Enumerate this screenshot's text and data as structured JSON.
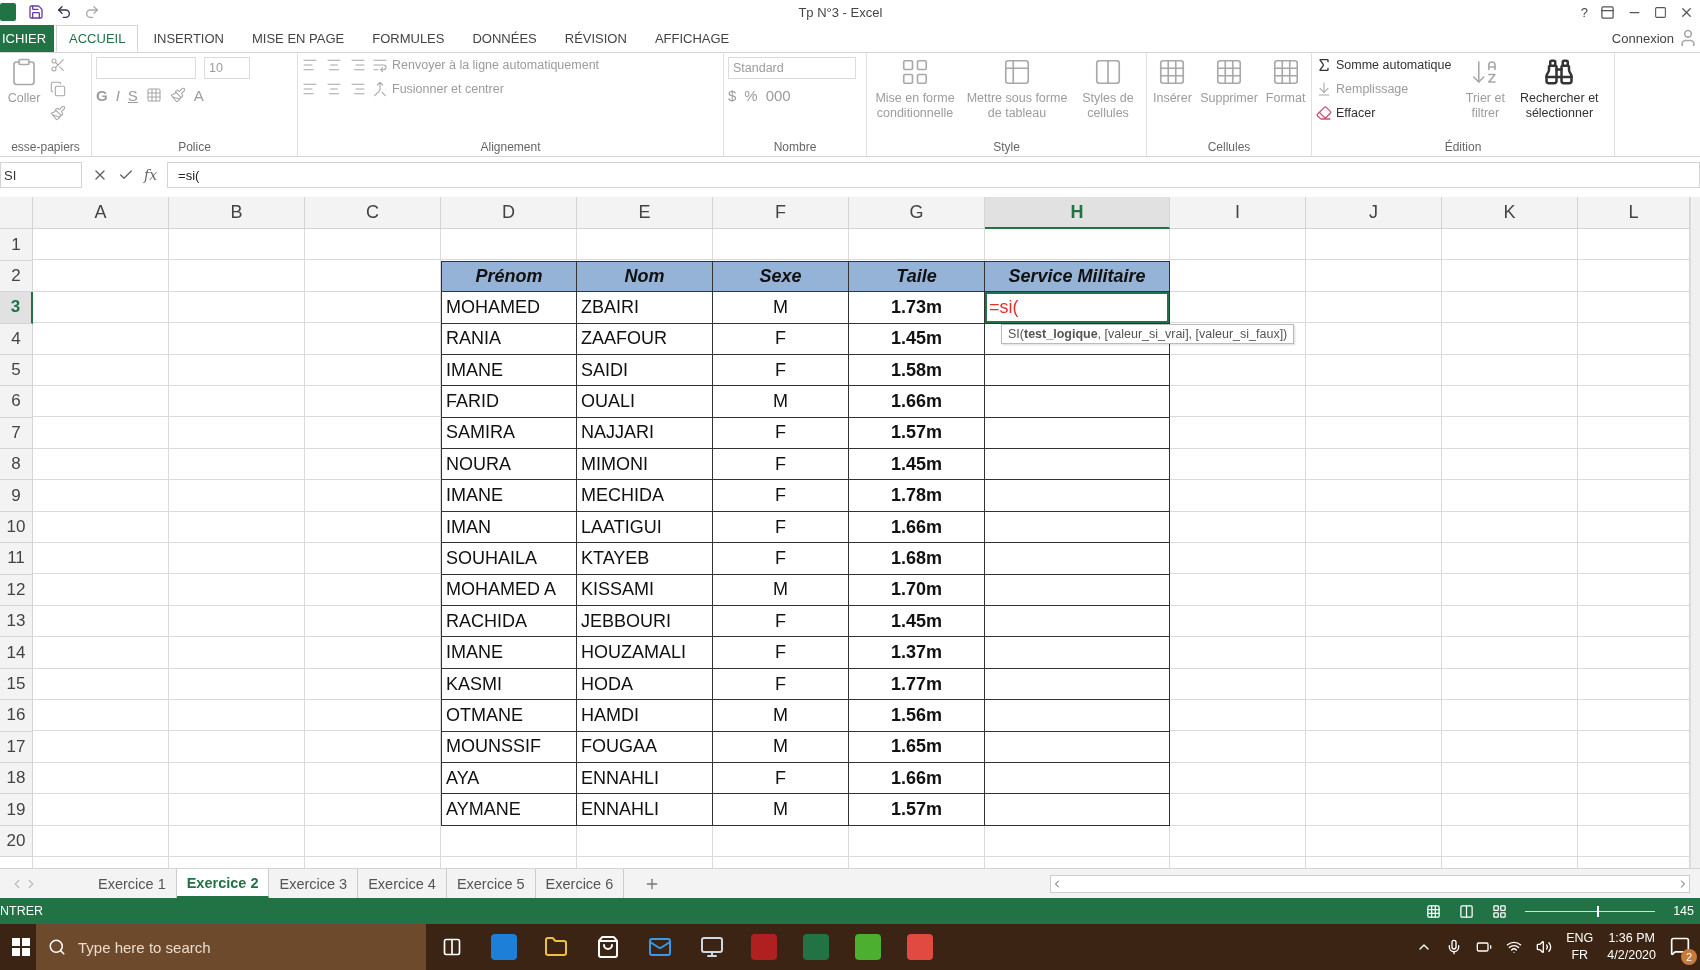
{
  "window": {
    "title": "Tp N°3 - Excel",
    "account": "Connexion",
    "help": "?"
  },
  "ribbon_tabs": [
    {
      "label": "ICHIER",
      "kind": "file",
      "selected": false
    },
    {
      "label": "ACCUEIL",
      "kind": "tab",
      "selected": true
    },
    {
      "label": "INSERTION",
      "kind": "tab",
      "selected": false
    },
    {
      "label": "MISE EN PAGE",
      "kind": "tab",
      "selected": false
    },
    {
      "label": "FORMULES",
      "kind": "tab",
      "selected": false
    },
    {
      "label": "DONNÉES",
      "kind": "tab",
      "selected": false
    },
    {
      "label": "RÉVISION",
      "kind": "tab",
      "selected": false
    },
    {
      "label": "AFFICHAGE",
      "kind": "tab",
      "selected": false
    }
  ],
  "ribbon": {
    "clipboard": {
      "label": "esse-papiers",
      "paste": "Coller"
    },
    "font": {
      "label": "Police",
      "size": "10",
      "bold": "G",
      "italic": "I",
      "underline": "S",
      "font_color": "A"
    },
    "alignment": {
      "label": "Alignement",
      "wrap": "Renvoyer à la ligne automatiquement",
      "merge": "Fusionner et centrer"
    },
    "number": {
      "label": "Nombre",
      "format": "Standard",
      "currency": "$",
      "percent": "%",
      "thousands": "000"
    },
    "style": {
      "label": "Style",
      "buttons": [
        "Mise en forme conditionnelle",
        "Mettre sous forme de tableau",
        "Styles de cellules"
      ]
    },
    "cells": {
      "label": "Cellules",
      "buttons": [
        "Insérer",
        "Supprimer",
        "Format"
      ]
    },
    "editing": {
      "label": "Édition",
      "autosum": "Somme automatique",
      "fill": "Remplissage",
      "clear": "Effacer",
      "sort": "Trier et filtrer",
      "find": "Rechercher et sélectionner"
    }
  },
  "formula_bar": {
    "name_box": "SI",
    "function_label": "fx",
    "formula": "=si("
  },
  "columns": [
    {
      "label": "A",
      "selected": false
    },
    {
      "label": "B",
      "selected": false
    },
    {
      "label": "C",
      "selected": false
    },
    {
      "label": "D",
      "selected": false
    },
    {
      "label": "E",
      "selected": false
    },
    {
      "label": "F",
      "selected": false
    },
    {
      "label": "G",
      "selected": false
    },
    {
      "label": "H",
      "selected": true
    },
    {
      "label": "I",
      "selected": false
    },
    {
      "label": "J",
      "selected": false
    },
    {
      "label": "K",
      "selected": false
    },
    {
      "label": "L",
      "selected": false
    }
  ],
  "row_headers": [
    {
      "label": "1",
      "selected": false
    },
    {
      "label": "2",
      "selected": false
    },
    {
      "label": "3",
      "selected": true
    },
    {
      "label": "4",
      "selected": false
    },
    {
      "label": "5",
      "selected": false
    },
    {
      "label": "6",
      "selected": false
    },
    {
      "label": "7",
      "selected": false
    },
    {
      "label": "8",
      "selected": false
    },
    {
      "label": "9",
      "selected": false
    },
    {
      "label": "10",
      "selected": false
    },
    {
      "label": "11",
      "selected": false
    },
    {
      "label": "12",
      "selected": false
    },
    {
      "label": "13",
      "selected": false
    },
    {
      "label": "14",
      "selected": false
    },
    {
      "label": "15",
      "selected": false
    },
    {
      "label": "16",
      "selected": false
    },
    {
      "label": "17",
      "selected": false
    },
    {
      "label": "18",
      "selected": false
    },
    {
      "label": "19",
      "selected": false
    },
    {
      "label": "20",
      "selected": false
    }
  ],
  "table": {
    "header": [
      "Prénom",
      "Nom",
      "Sexe",
      "Taile",
      "Service Militaire"
    ],
    "rows": [
      [
        "MOHAMED",
        "ZBAIRI",
        "M",
        "1.73m"
      ],
      [
        "RANIA",
        "ZAAFOUR",
        "F",
        "1.45m"
      ],
      [
        "IMANE",
        "SAIDI",
        "F",
        "1.58m"
      ],
      [
        "FARID",
        "OUALI",
        "M",
        "1.66m"
      ],
      [
        "SAMIRA",
        "NAJJARI",
        "F",
        "1.57m"
      ],
      [
        "NOURA",
        "MIMONI",
        "F",
        "1.45m"
      ],
      [
        "IMANE",
        "MECHIDA",
        "F",
        "1.78m"
      ],
      [
        "IMAN",
        "LAATIGUI",
        "F",
        "1.66m"
      ],
      [
        "SOUHAILA",
        "KTAYEB",
        "F",
        "1.68m"
      ],
      [
        "MOHAMED A",
        "KISSAMI",
        "M",
        "1.70m"
      ],
      [
        "RACHIDA",
        "JEBBOURI",
        "F",
        "1.45m"
      ],
      [
        "IMANE",
        "HOUZAMALI",
        "F",
        "1.37m"
      ],
      [
        "KASMI",
        "HODA",
        "F",
        "1.77m"
      ],
      [
        "OTMANE",
        "HAMDI",
        "M",
        "1.56m"
      ],
      [
        "MOUNSSIF",
        "FOUGAA",
        "M",
        "1.65m"
      ],
      [
        "AYA",
        "ENNAHLI",
        "F",
        "1.66m"
      ],
      [
        "AYMANE",
        "ENNAHLI",
        "M",
        "1.57m"
      ]
    ],
    "editing_cell": {
      "value": "=si(",
      "hint": "SI(**test_logique**, [valeur_si_vrai], [valeur_si_faux])"
    }
  },
  "sheet_tabs": [
    {
      "label": "Exercice 1",
      "selected": false
    },
    {
      "label": "Exercice 2",
      "selected": true
    },
    {
      "label": "Exercice 3",
      "selected": false
    },
    {
      "label": "Exercice 4",
      "selected": false
    },
    {
      "label": "Exercice 5",
      "selected": false
    },
    {
      "label": "Exercice 6",
      "selected": false
    }
  ],
  "status_bar": {
    "mode": "NTRER",
    "zoom": {
      "label": "145",
      "level": 0.55
    }
  },
  "taskbar": {
    "search": {
      "placeholder": "Type here to search"
    },
    "language": "ENG",
    "layout": "FR",
    "time": "1:36 PM",
    "date": "4/2/2020",
    "notifications": "2"
  }
}
